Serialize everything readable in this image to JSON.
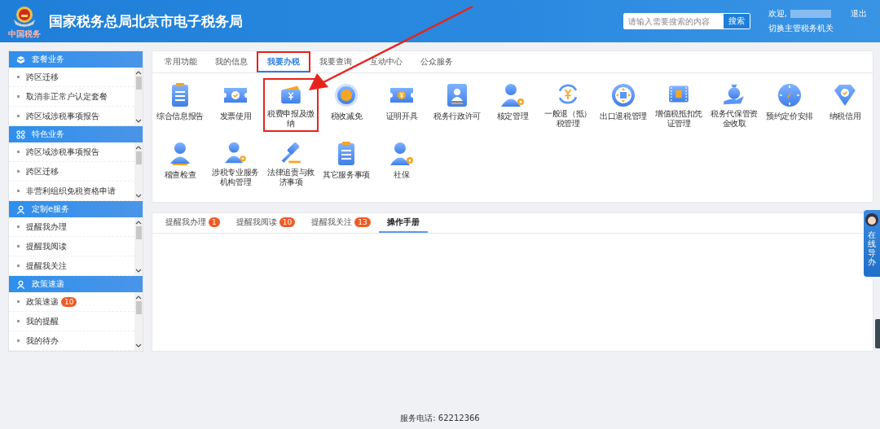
{
  "header": {
    "title": "国家税务总局北京市电子税务局",
    "logo_caption": "中国税务",
    "search": {
      "placeholder": "请输入需要搜索的内容",
      "button": "搜索"
    },
    "welcome": "欢迎,",
    "logout": "退出",
    "switch_office": "切换主管税务机关"
  },
  "sidebar": [
    {
      "title": "套餐业务",
      "items": [
        {
          "label": "跨区迁移"
        },
        {
          "label": "取消非正常户认定套餐"
        },
        {
          "label": "跨区域涉税事项报告"
        }
      ]
    },
    {
      "title": "特色业务",
      "items": [
        {
          "label": "跨区域涉税事项报告"
        },
        {
          "label": "跨区迁移"
        },
        {
          "label": "非营利组织免税资格申请"
        }
      ]
    },
    {
      "title": "定制e服务",
      "items": [
        {
          "label": "提醒我办理"
        },
        {
          "label": "提醒我阅读"
        },
        {
          "label": "提醒我关注"
        }
      ]
    },
    {
      "title": "政策速递",
      "items": [
        {
          "label": "政策速递",
          "badge": "10"
        },
        {
          "label": "我的提醒"
        },
        {
          "label": "我的待办"
        }
      ]
    }
  ],
  "main_tabs": [
    {
      "label": "常用功能",
      "selected": false,
      "highlighted": false
    },
    {
      "label": "我的信息",
      "selected": false,
      "highlighted": false
    },
    {
      "label": "我要办税",
      "selected": true,
      "highlighted": true
    },
    {
      "label": "我要查询",
      "selected": false,
      "highlighted": false
    },
    {
      "label": "互动中心",
      "selected": false,
      "highlighted": false
    },
    {
      "label": "公众服务",
      "selected": false,
      "highlighted": false
    }
  ],
  "functions": [
    {
      "label": "综合信息报告",
      "kind": "clipboard",
      "highlighted": false
    },
    {
      "label": "发票使用",
      "kind": "ticket",
      "highlighted": false
    },
    {
      "label": "税费申报及缴纳",
      "kind": "wallet",
      "highlighted": true
    },
    {
      "label": "税收减免",
      "kind": "coin",
      "highlighted": false
    },
    {
      "label": "证明开具",
      "kind": "ticket-yuan",
      "highlighted": false
    },
    {
      "label": "税务行政许可",
      "kind": "card",
      "highlighted": false
    },
    {
      "label": "核定管理",
      "kind": "person-gear",
      "highlighted": false
    },
    {
      "label": "一般退（抵）税管理",
      "kind": "refresh",
      "highlighted": false
    },
    {
      "label": "出口退税管理",
      "kind": "globe",
      "highlighted": false
    },
    {
      "label": "增值税抵扣凭证管理",
      "kind": "film",
      "highlighted": false
    },
    {
      "label": "税务代保管资金收取",
      "kind": "bag",
      "highlighted": false
    },
    {
      "label": "预约定价安排",
      "kind": "compass",
      "highlighted": false
    },
    {
      "label": "纳税信用",
      "kind": "diamond",
      "highlighted": false
    },
    {
      "label": "稽查检查",
      "kind": "person",
      "highlighted": false
    },
    {
      "label": "涉税专业服务机构管理",
      "kind": "person-gear",
      "highlighted": false
    },
    {
      "label": "法律追责与救济事项",
      "kind": "gavel",
      "highlighted": false
    },
    {
      "label": "其它服务事项",
      "kind": "clipboard",
      "highlighted": false
    },
    {
      "label": "社保",
      "kind": "person-gear",
      "highlighted": false
    }
  ],
  "reminder_tabs": [
    {
      "label": "提醒我办理",
      "badge": "1",
      "selected": false
    },
    {
      "label": "提醒我阅读",
      "badge": "10",
      "selected": false
    },
    {
      "label": "提醒我关注",
      "badge": "13",
      "selected": false
    },
    {
      "label": "操作手册",
      "selected": true
    }
  ],
  "side_widget": {
    "label": "在线导办"
  },
  "footer": {
    "label": "服务电话:",
    "phone": "62212366"
  }
}
